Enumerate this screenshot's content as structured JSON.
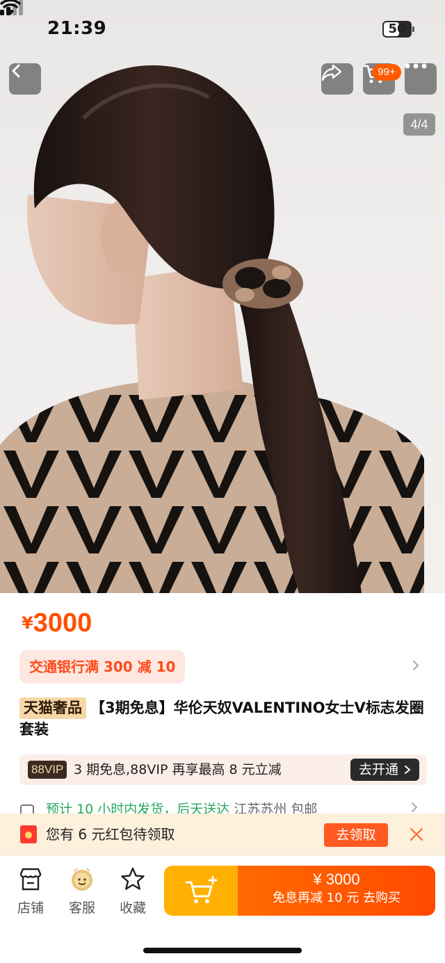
{
  "status_bar": {
    "time": "21:39",
    "battery": "50"
  },
  "nav": {
    "cart_badge": "99+",
    "image_index": "4/4",
    "icons": [
      "back-icon",
      "share-icon",
      "cart-icon",
      "more-icon"
    ]
  },
  "product": {
    "price_symbol": "¥",
    "price": "3000",
    "coupon": "交通银行满 300 减 10",
    "title_tag": "天猫奢品",
    "title": "【3期免息】华伦天奴VALENTINO女士V标志发圈套装"
  },
  "vip": {
    "badge": "88VIP",
    "text": "3 期免息,88VIP 再享最高 8 元立减",
    "button": "去开通"
  },
  "shipping": {
    "text_green": "预计 10 小时内发货，后天送达",
    "text_grey": "江苏苏州  包邮"
  },
  "redpack": {
    "text": "您有 6 元红包待领取",
    "button": "去领取"
  },
  "tabbar": {
    "store": "店铺",
    "service": "客服",
    "favorite": "收藏"
  },
  "cta": {
    "price": "¥ 3000",
    "subtitle": "免息再减 10 元  去购买"
  },
  "colors": {
    "accent": "#ff5000",
    "cart_button": "#ffb000",
    "buy_button": "#ff5a00",
    "vip_bg": "#fbeee8",
    "redpack_bg": "#fdf0dc"
  }
}
